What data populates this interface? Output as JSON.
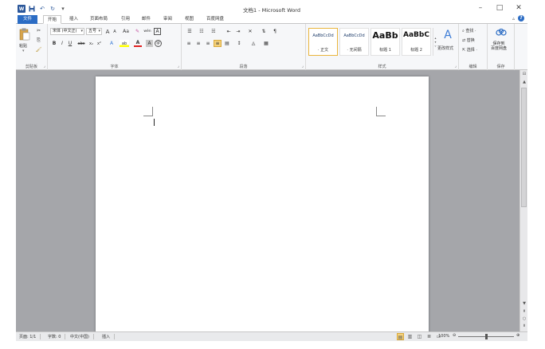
{
  "titlebar": {
    "title": "文档1 - Microsoft Word",
    "qat_icons": [
      "word-logo",
      "save-icon",
      "undo-icon",
      "redo-icon",
      "customize-icon"
    ],
    "word_logo_text": "W",
    "controls": [
      "–",
      "□",
      "✕"
    ]
  },
  "tabs": {
    "file": "文件",
    "items": [
      "开始",
      "插入",
      "页面布局",
      "引用",
      "邮件",
      "审阅",
      "视图",
      "百度网盘"
    ],
    "active": "开始",
    "help": "?",
    "collapse": "▵"
  },
  "ribbon": {
    "clipboard": {
      "label": "剪贴板",
      "paste": "粘贴"
    },
    "font": {
      "label": "字体",
      "font_name": "宋体 (中文正)",
      "font_size": "五号",
      "grow": "A",
      "shrink": "A",
      "case": "Aa",
      "clear": "✎",
      "phonetic": "wén",
      "border": "A",
      "bold": "B",
      "italic": "I",
      "underline": "U",
      "strike": "abc",
      "subscript": "x₂",
      "superscript": "x²",
      "effects": "A",
      "highlight": "ab",
      "color": "A",
      "shade": "A",
      "enclose": "字"
    },
    "paragraph": {
      "label": "段落"
    },
    "styles": {
      "label": "样式",
      "items": [
        {
          "sample": "AaBbCcDd",
          "name": "· 正文"
        },
        {
          "sample": "AaBbCcDd",
          "name": "· 无间隔"
        },
        {
          "sample": "AaBb",
          "name": "标题 1"
        },
        {
          "sample": "AaBbC",
          "name": "标题 2"
        }
      ],
      "change": "更改样式"
    },
    "editing": {
      "label": "编辑",
      "find": "查找 ·",
      "replace": "替换",
      "select": "选择 ·"
    },
    "save": {
      "label": "保存",
      "button": "保存到\n百度网盘"
    }
  },
  "statusbar": {
    "page": "页面: 1/1",
    "words": "字数: 0",
    "language": "中文(中国)",
    "mode": "插入",
    "zoom": "100%",
    "zoom_fraction": 0.5
  },
  "colors": {
    "accent": "#2b579a",
    "file_tab": "#2b6cc4",
    "workspace": "#a5a6aa",
    "selected_style": "#e9b53c"
  }
}
